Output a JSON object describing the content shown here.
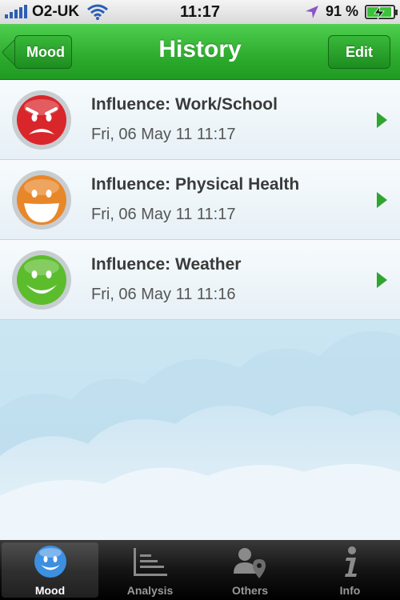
{
  "status_bar": {
    "carrier": "O2-UK",
    "time": "11:17",
    "battery": "91 %",
    "battery_level": 0.91
  },
  "nav": {
    "title": "History",
    "back_label": "Mood",
    "edit_label": "Edit"
  },
  "entries": [
    {
      "title": "Influence: Work/School",
      "date": "Fri, 06 May 11 11:17",
      "mood": "angry-red-face"
    },
    {
      "title": "Influence: Physical Health",
      "date": "Fri, 06 May 11 11:17",
      "mood": "happy-orange-face"
    },
    {
      "title": "Influence: Weather",
      "date": "Fri, 06 May 11 11:16",
      "mood": "smiling-green-face"
    }
  ],
  "tabs": [
    {
      "label": "Mood",
      "icon": "smiley-icon",
      "active": true
    },
    {
      "label": "Analysis",
      "icon": "chart-icon",
      "active": false
    },
    {
      "label": "Others",
      "icon": "people-location-icon",
      "active": false
    },
    {
      "label": "Info",
      "icon": "info-icon",
      "active": false
    }
  ],
  "colors": {
    "accent_green": "#2fae2f",
    "angry_red": "#d9262b",
    "orange": "#e8872a",
    "green_face": "#5cbd2c"
  }
}
